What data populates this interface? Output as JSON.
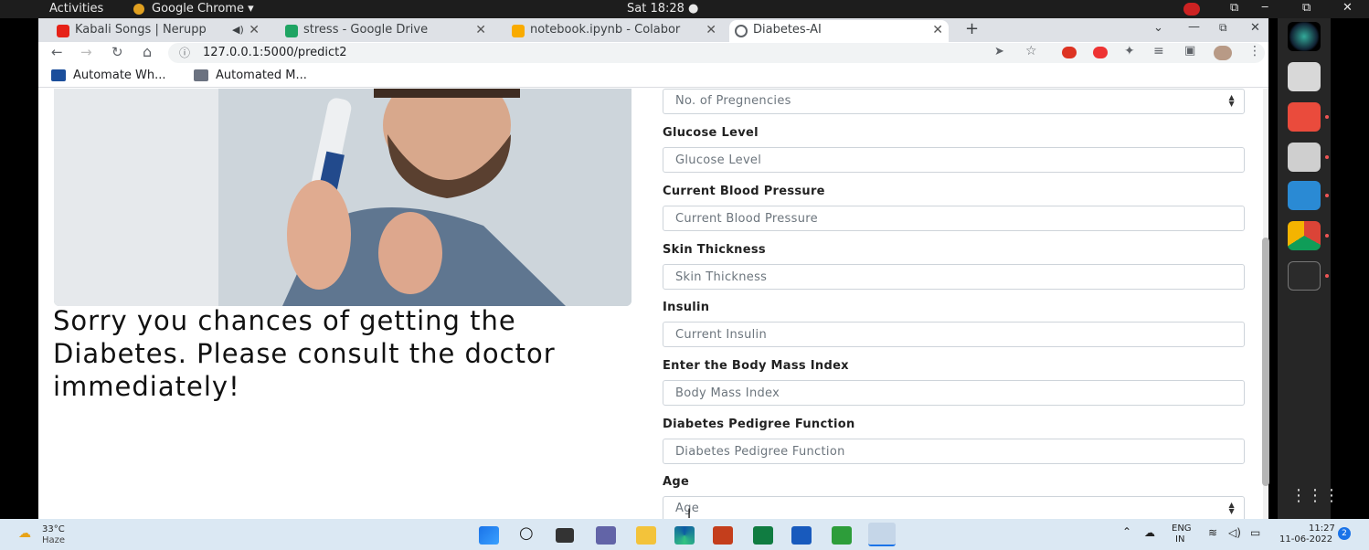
{
  "topbar": {
    "activities": "Activities",
    "app": "Google Chrome ▾",
    "clock": "Sat 18:28 ●"
  },
  "tabs": [
    {
      "label": "Kabali Songs | Nerupp",
      "fav": "#e62117",
      "extra": "🔈"
    },
    {
      "label": "stress - Google Drive",
      "fav": "#1fa463"
    },
    {
      "label": "notebook.ipynb - Colabor",
      "fav": "#f9ab00"
    },
    {
      "label": "Diabetes-AI",
      "fav": "#5f6368"
    }
  ],
  "new_tab": "+",
  "address": "127.0.0.1:5000/predict2",
  "bookmarks": [
    {
      "label": "Automate Wh..."
    },
    {
      "label": "Automated M..."
    }
  ],
  "result_text": "Sorry you chances of getting the Diabetes. Please consult the doctor immediately!",
  "form": {
    "pregnancies_placeholder": "No. of Pregnencies",
    "glucose_label": "Glucose Level",
    "glucose_placeholder": "Glucose Level",
    "bp_label": "Current Blood Pressure",
    "bp_placeholder": "Current Blood Pressure",
    "skin_label": "Skin Thickness",
    "skin_placeholder": "Skin Thickness",
    "insulin_label": "Insulin",
    "insulin_placeholder": "Current Insulin",
    "bmi_label": "Enter the Body Mass Index",
    "bmi_placeholder": "Body Mass Index",
    "dpf_label": "Diabetes Pedigree Function",
    "dpf_placeholder": "Diabetes Pedigree Function",
    "age_label": "Age",
    "age_placeholder": "Age"
  },
  "weather": {
    "temp": "33°C",
    "desc": "Haze"
  },
  "tray": {
    "lang1": "ENG",
    "lang2": "IN",
    "time": "11:27",
    "date": "11-06-2022",
    "badge": "2"
  }
}
